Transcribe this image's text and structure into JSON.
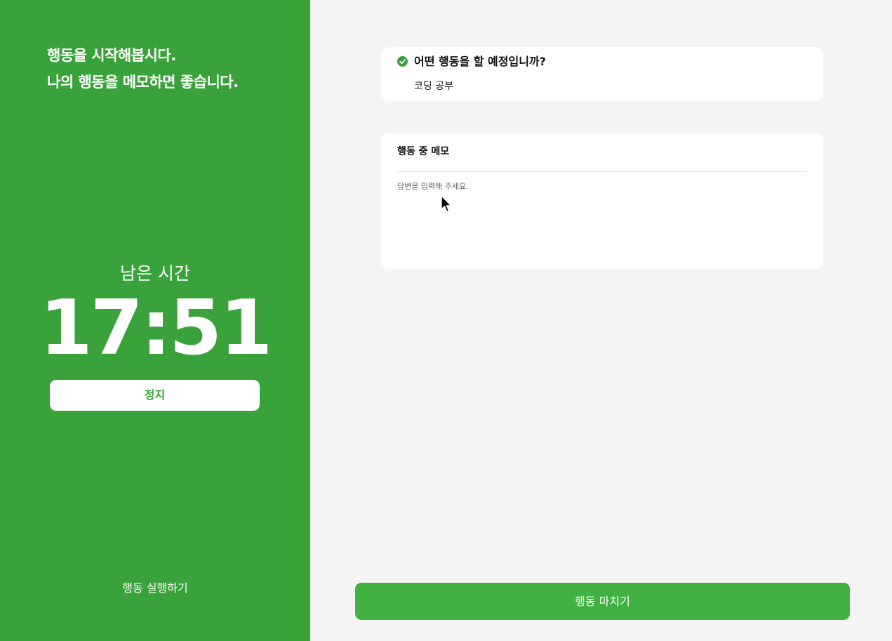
{
  "left_panel": {
    "headline_line1": "행동을 시작해봅시다.",
    "headline_line2": "나의 행동을 메모하면 좋습니다.",
    "remaining_label": "남은 시간",
    "timer": "17:51",
    "stop_button_label": "정지",
    "footer_label": "행동 실행하기"
  },
  "question_card": {
    "title": "어떤 행동을 할 예정입니까?",
    "answer": "코딩 공부"
  },
  "memo_card": {
    "title": "행동 중 메모",
    "placeholder": "답변을 입력해 주세요."
  },
  "finish_button_label": "행동 마치기",
  "colors": {
    "brand_green": "#3aa23a",
    "button_green": "#41b141",
    "background": "#f4f4f4",
    "card": "#ffffff"
  },
  "icons": {
    "check": "check-circle-icon",
    "pointer": "mouse-cursor-icon"
  }
}
